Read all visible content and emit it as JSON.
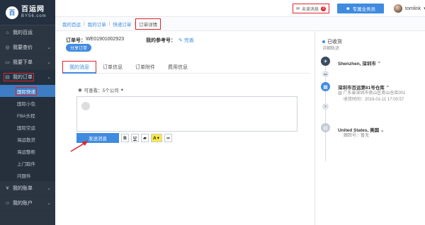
{
  "logo": {
    "cn": "百运网",
    "en": "BY56.com",
    "mark": "百"
  },
  "sidebar": {
    "items": [
      {
        "label": "我的百运",
        "icon": "home-icon"
      },
      {
        "label": "我要查价",
        "icon": "search-icon",
        "chevron": "⌄"
      },
      {
        "label": "我要下单",
        "icon": "cart-icon",
        "chevron": "⌄"
      },
      {
        "label": "我的订单",
        "icon": "list-icon",
        "chevron": "⌄"
      }
    ],
    "sub_items": [
      "国际快递",
      "国际小包",
      "FBA头程",
      "国际空运",
      "海运散货",
      "海运整柜",
      "上门取件",
      "问题件"
    ],
    "bottom_items": [
      {
        "label": "我的账单",
        "icon": "bill-icon",
        "chevron": "⌄"
      },
      {
        "label": "我的账户",
        "icon": "user-icon",
        "chevron": "⌄"
      }
    ]
  },
  "topbar": {
    "unread_label": "未读消息",
    "unread_count": "3",
    "agent_label": "专属业务员",
    "username": "tomlink"
  },
  "breadcrumb": [
    "我的百运",
    "我的订单",
    "快递订单",
    "订单详情"
  ],
  "order": {
    "number_label": "订单号：",
    "number": "WE01901002923",
    "ref_label": "我的参考号：",
    "ref_edit": "完善",
    "share_label": "分享订单"
  },
  "tabs": [
    "我的消息",
    "订单信息",
    "订单附件",
    "费用信息"
  ],
  "message": {
    "visibility": "可查看：5个公司",
    "send_label": "发送消息",
    "tools": [
      "B",
      "U",
      "A"
    ]
  },
  "tracking": {
    "status": "已收货",
    "track_label": "详细轨迹",
    "origin": "Shenzhen, 深圳市",
    "warehouse": "深圳市百运第81号仓库",
    "warehouse_addr": "广东省深圳市南山区南山仓库001",
    "received_time": "收货时间：2019-01-11 17:00:57",
    "destination": "United States, 美国",
    "agent_label": "跟踪号：暂无"
  },
  "colors": {
    "accent": "#3f8be0",
    "sidebar_bg": "#2c3643",
    "highlight": "#e0242b"
  }
}
